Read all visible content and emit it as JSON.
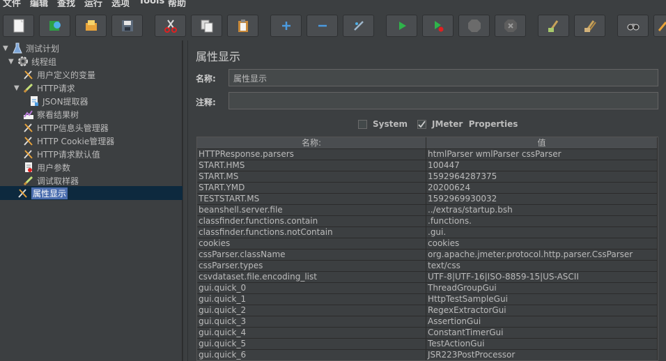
{
  "menubar": {
    "items": [
      "文件",
      "编辑",
      "查找",
      "运行",
      "选项",
      "Tools",
      "帮助"
    ]
  },
  "toolbar": {
    "buttons": [
      "new-icon",
      "templates-icon",
      "open-icon",
      "save-icon",
      "cut-icon",
      "copy-icon",
      "paste-icon",
      "expand-icon",
      "collapse-icon",
      "toggle-icon",
      "start-icon",
      "start-no-pause-icon",
      "stop-icon",
      "shutdown-icon",
      "clear-icon",
      "clear-all-icon",
      "search-icon",
      "reset-search-icon"
    ]
  },
  "tree": {
    "nodes": [
      {
        "label": "测试计划",
        "icon": "test-plan-icon",
        "expanded": true
      },
      {
        "label": "线程组",
        "icon": "thread-group-icon",
        "expanded": true
      },
      {
        "label": "用户定义的变量",
        "icon": "config-icon"
      },
      {
        "label": "HTTP请求",
        "icon": "sampler-icon",
        "expanded": true
      },
      {
        "label": "JSON提取器",
        "icon": "extractor-icon"
      },
      {
        "label": "察看结果树",
        "icon": "listener-icon"
      },
      {
        "label": "HTTP信息头管理器",
        "icon": "config-icon"
      },
      {
        "label": "HTTP Cookie管理器",
        "icon": "config-icon"
      },
      {
        "label": "HTTP请求默认值",
        "icon": "config-icon"
      },
      {
        "label": "用户参数",
        "icon": "preprocessor-icon"
      },
      {
        "label": "调试取样器",
        "icon": "sampler-icon"
      },
      {
        "label": "属性显示",
        "icon": "config-icon",
        "selected": true
      }
    ]
  },
  "panel": {
    "title": "属性显示",
    "name_label": "名称:",
    "name_value": "属性显示",
    "comment_label": "注释:",
    "comment_value": "",
    "system_label": "System",
    "system_checked": false,
    "jmeter_label": "JMeter  Properties",
    "jmeter_checked": true
  },
  "table": {
    "headers": [
      "名称:",
      "值"
    ],
    "rows": [
      [
        "HTTPResponse.parsers",
        "htmlParser wmlParser cssParser"
      ],
      [
        "START.HMS",
        "100447"
      ],
      [
        "START.MS",
        "1592964287375"
      ],
      [
        "START.YMD",
        "20200624"
      ],
      [
        "TESTSTART.MS",
        "1592969930032"
      ],
      [
        "beanshell.server.file",
        "../extras/startup.bsh"
      ],
      [
        "classfinder.functions.contain",
        ".functions."
      ],
      [
        "classfinder.functions.notContain",
        ".gui."
      ],
      [
        "cookies",
        "cookies"
      ],
      [
        "cssParser.className",
        "org.apache.jmeter.protocol.http.parser.CssParser"
      ],
      [
        "cssParser.types",
        "text/css"
      ],
      [
        "csvdataset.file.encoding_list",
        "UTF-8|UTF-16|ISO-8859-15|US-ASCII"
      ],
      [
        "gui.quick_0",
        "ThreadGroupGui"
      ],
      [
        "gui.quick_1",
        "HttpTestSampleGui"
      ],
      [
        "gui.quick_2",
        "RegexExtractorGui"
      ],
      [
        "gui.quick_3",
        "AssertionGui"
      ],
      [
        "gui.quick_4",
        "ConstantTimerGui"
      ],
      [
        "gui.quick_5",
        "TestActionGui"
      ],
      [
        "gui.quick_6",
        "JSR223PostProcessor"
      ]
    ]
  },
  "colors": {
    "background": "#3c3f41",
    "selection": "#4b6eaf",
    "selection_row": "#0d293e",
    "text": "#bbbbbb"
  }
}
